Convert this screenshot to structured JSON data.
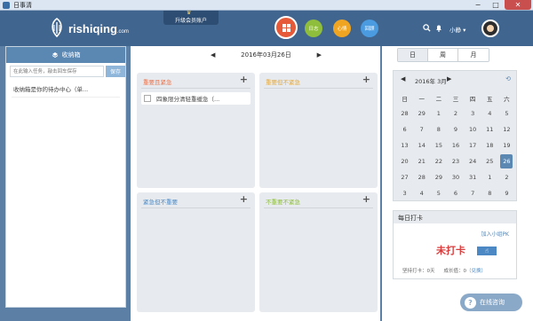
{
  "window": {
    "title": "日事清",
    "minimize": "−",
    "maximize": "□",
    "close": "✕"
  },
  "header": {
    "logo_text": "rishiqing",
    "logo_suffix": ".com",
    "upgrade_label": "升级会员账户",
    "nav": {
      "diary": "日志",
      "mood": "心情",
      "review": "回顾"
    },
    "user_name": "小静",
    "user_caret": "▾",
    "icons": {
      "search": "search-icon",
      "bell": "bell-icon"
    }
  },
  "inbox": {
    "title": "收纳箱",
    "input_placeholder": "在此输入任务，敲击回车保存",
    "save_label": "保存",
    "items": [
      "收纳箱是你的待办中心（单..."
    ]
  },
  "center": {
    "date": "2016年03月26日",
    "quadrants": [
      {
        "title": "重要且紧急",
        "color": "#e8724a",
        "tasks": [
          "四象限分清轻重缓急（..."
        ]
      },
      {
        "title": "重要但不紧急",
        "color": "#e6a93c",
        "tasks": []
      },
      {
        "title": "紧急但不重要",
        "color": "#4b88c4",
        "tasks": []
      },
      {
        "title": "不重要不紧急",
        "color": "#8dbd3a",
        "tasks": []
      }
    ]
  },
  "views": {
    "day": "日",
    "week": "周",
    "month": "月"
  },
  "calendar": {
    "month_label": "2016年 3月",
    "weekdays": [
      "日",
      "一",
      "二",
      "三",
      "四",
      "五",
      "六"
    ],
    "days": [
      [
        "28",
        "29",
        "1",
        "2",
        "3",
        "4",
        "5"
      ],
      [
        "6",
        "7",
        "8",
        "9",
        "10",
        "11",
        "12"
      ],
      [
        "13",
        "14",
        "15",
        "16",
        "17",
        "18",
        "19"
      ],
      [
        "20",
        "21",
        "22",
        "23",
        "24",
        "25",
        "26"
      ],
      [
        "27",
        "28",
        "29",
        "30",
        "31",
        "1",
        "2"
      ],
      [
        "3",
        "4",
        "5",
        "6",
        "7",
        "8",
        "9"
      ]
    ],
    "selected": "26"
  },
  "punch": {
    "title": "每日打卡",
    "join_pk": "加入小组PK",
    "status": "未打卡",
    "streak_label": "坚持打卡：0天",
    "score_label": "成长值：0",
    "score_link": "（兑换）"
  },
  "consult_label": "在线咨询",
  "colors": {
    "header": "#40658f",
    "accent": "#5b87b3",
    "status_red": "#d83c3c"
  }
}
